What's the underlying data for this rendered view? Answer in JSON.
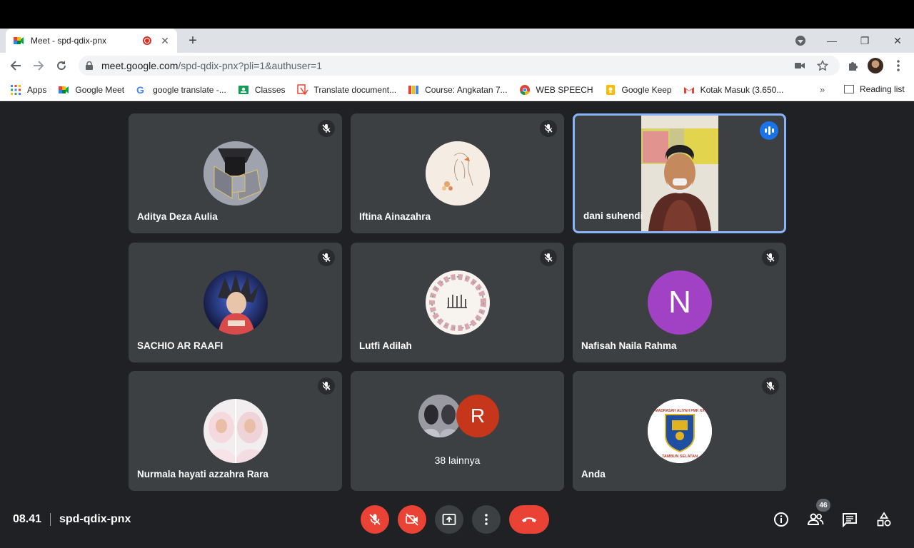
{
  "browser": {
    "tab_title": "Meet - spd-qdix-pnx",
    "tab_close": "✕",
    "new_tab": "+",
    "url_host": "meet.google.com",
    "url_path": "/spd-qdix-pnx?pli=1&authuser=1",
    "window_controls": {
      "minimize": "—",
      "maximize": "❐",
      "close": "✕"
    }
  },
  "bookmarks": [
    {
      "label": "Apps",
      "icon": "apps-grid-icon",
      "color": "#4285f4"
    },
    {
      "label": "Google Meet",
      "icon": "google-meet-icon",
      "color": "#00832d"
    },
    {
      "label": "google translate -...",
      "icon": "google-icon",
      "color": "#4285f4"
    },
    {
      "label": "Classes",
      "icon": "classroom-icon",
      "color": "#0f9d58"
    },
    {
      "label": "Translate document...",
      "icon": "translate-icon",
      "color": "#ea4335"
    },
    {
      "label": "Course: Angkatan 7...",
      "icon": "course-icon",
      "color": "#f4b400"
    },
    {
      "label": "WEB SPEECH",
      "icon": "chrome-icon",
      "color": "#db4437"
    },
    {
      "label": "Google Keep",
      "icon": "keep-icon",
      "color": "#fbbc04"
    },
    {
      "label": "Kotak Masuk (3.650...",
      "icon": "gmail-icon",
      "color": "#ea4335"
    }
  ],
  "bookmarks_more": "»",
  "reading_list": "Reading list",
  "participants": [
    {
      "name": "Aditya Deza Aulia"
    },
    {
      "name": "Iftina Ainazahra"
    },
    {
      "name": "dani suhendi"
    },
    {
      "name": "SACHIO AR RAAFI"
    },
    {
      "name": "Lutfi Adilah"
    },
    {
      "name": "Nafisah Naila Rahma",
      "initial": "N"
    },
    {
      "name": "Nurmala hayati azzahra Rara"
    },
    {
      "others": "38 lainnya",
      "initial": "R"
    },
    {
      "name": "Anda",
      "logo_text_top": "MADRASAH ALIYAH PMK XX",
      "logo_text_bottom": "TAMBUN SELATAN"
    }
  ],
  "meeting": {
    "time": "08.41",
    "code": "spd-qdix-pnx",
    "participant_count": "46"
  },
  "colors": {
    "accent_blue": "#1a73e8",
    "end_call_red": "#ea4335",
    "bg_dark": "#202124",
    "tile": "#3c4043"
  }
}
